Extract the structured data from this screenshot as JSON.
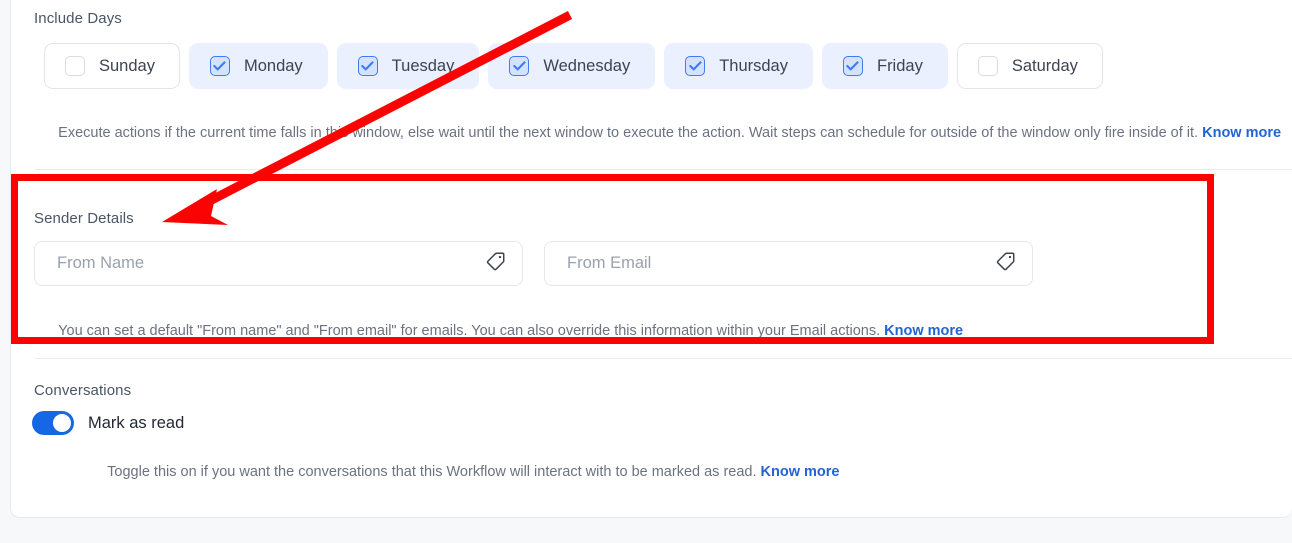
{
  "include_days": {
    "label": "Include Days",
    "days": [
      {
        "name": "Sunday",
        "checked": false
      },
      {
        "name": "Monday",
        "checked": true
      },
      {
        "name": "Tuesday",
        "checked": true
      },
      {
        "name": "Wednesday",
        "checked": true
      },
      {
        "name": "Thursday",
        "checked": true
      },
      {
        "name": "Friday",
        "checked": true
      },
      {
        "name": "Saturday",
        "checked": false
      }
    ],
    "helper_text": "Execute actions if the current time falls in this window, else wait until the next window to execute the action. Wait steps can schedule for outside of the window only fire inside of it. ",
    "helper_link": "Know more"
  },
  "sender_details": {
    "label": "Sender Details",
    "from_name": {
      "placeholder": "From Name",
      "value": "",
      "icon": "tag-icon"
    },
    "from_email": {
      "placeholder": "From Email",
      "value": "",
      "icon": "tag-icon"
    },
    "helper_text": "You can set a default \"From name\" and \"From email\" for emails. You can also override this information within your Email actions. ",
    "helper_link": "Know more"
  },
  "conversations": {
    "label": "Conversations",
    "toggle_label": "Mark as read",
    "toggle_on": true,
    "helper_text": "Toggle this on if you want the conversations that this Workflow will interact with to be marked as read. ",
    "helper_link": "Know more"
  },
  "annotation": {
    "highlight_color": "#fb0203",
    "arrow_color": "#fb0203",
    "arrow_from": "570,15",
    "arrow_to": "162,222"
  },
  "colors": {
    "accent": "#1667e3",
    "link": "#2264d1",
    "chip_on_bg": "#eaf0fe",
    "text": "#3d4451",
    "muted": "#6b7280"
  }
}
